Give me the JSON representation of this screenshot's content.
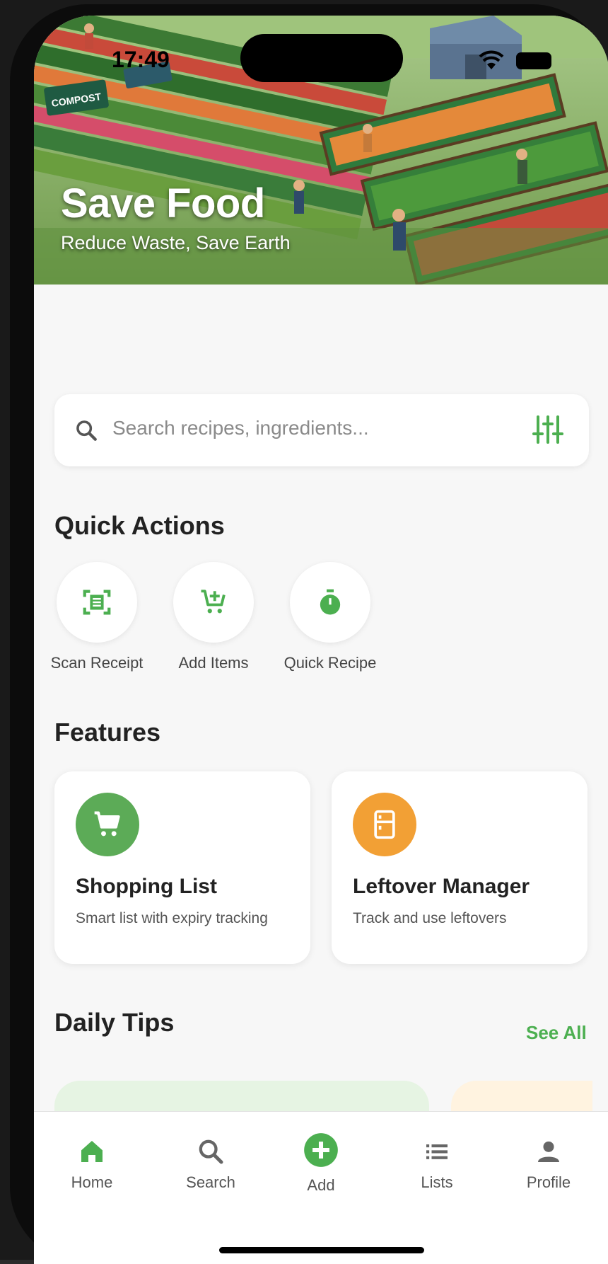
{
  "status_bar": {
    "time": "17:49"
  },
  "hero": {
    "title": "Save Food",
    "subtitle": "Reduce Waste, Save Earth",
    "sign_text": "COMPOST"
  },
  "search": {
    "placeholder": "Search recipes, ingredients..."
  },
  "quick_actions": {
    "title": "Quick Actions",
    "items": [
      {
        "label": "Scan Receipt",
        "icon": "scan-receipt-icon"
      },
      {
        "label": "Add Items",
        "icon": "cart-plus-icon"
      },
      {
        "label": "Quick Recipe",
        "icon": "timer-icon"
      }
    ]
  },
  "features": {
    "title": "Features",
    "items": [
      {
        "title": "Shopping List",
        "description": "Smart list with expiry tracking",
        "icon": "cart-icon",
        "color": "#5cab57"
      },
      {
        "title": "Leftover Manager",
        "description": "Track and use leftovers",
        "icon": "fridge-icon",
        "color": "#f2a035"
      }
    ]
  },
  "daily_tips": {
    "title": "Daily Tips",
    "see_all": "See All"
  },
  "nav": {
    "items": [
      {
        "label": "Home",
        "icon": "home-icon"
      },
      {
        "label": "Search",
        "icon": "search-icon"
      },
      {
        "label": "Add",
        "icon": "add-circle-icon"
      },
      {
        "label": "Lists",
        "icon": "list-icon"
      },
      {
        "label": "Profile",
        "icon": "person-icon"
      }
    ]
  },
  "colors": {
    "accent": "#4caf50",
    "orange": "#f2a035",
    "background": "#f7f7f7"
  }
}
